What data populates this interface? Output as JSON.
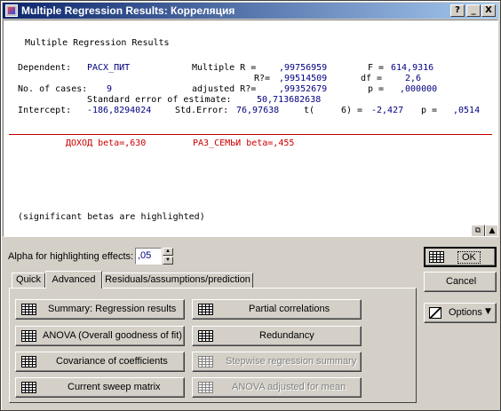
{
  "window": {
    "title": "Multiple Regression Results: Корреляция"
  },
  "titlebar_buttons": {
    "help": "?",
    "minimize": "_",
    "close": "X"
  },
  "output": {
    "heading": "Multiple Regression Results",
    "line1": {
      "dep_label": "Dependent:",
      "dep_value": "РАСХ_ПИТ",
      "multr_label": "Multiple R =",
      "multr_value": ",99756959",
      "f_label": "F =",
      "f_value": "614,9316"
    },
    "line2": {
      "r2_label": "R?=",
      "r2_value": ",99514509",
      "df_label": "df =",
      "df_value": "2,6"
    },
    "line3": {
      "cases_label": "No. of cases:",
      "cases_value": "9",
      "adjr2_label": "adjusted R?=",
      "adjr2_value": ",99352679",
      "p_label": "p =",
      "p_value": ",000000"
    },
    "line4": {
      "se_label": "Standard error of estimate:",
      "se_value": "50,713682638"
    },
    "line5": {
      "int_label": "Intercept:",
      "int_value": "-186,8294024",
      "stderr_label": "Std.Error:",
      "stderr_value": "76,97638",
      "t_label": "t(",
      "t_df": "6) =",
      "t_value": "-2,427",
      "p2_label": "p =",
      "p2_value": ",0514"
    },
    "betas": [
      {
        "text": "ДОХОД beta=,630"
      },
      {
        "text": "РАЗ_СЕМЬИ beta=,455"
      }
    ],
    "footnote": "(significant betas are highlighted)"
  },
  "alpha": {
    "label": "Alpha for highlighting effects:",
    "value": ",05"
  },
  "tabs": [
    {
      "label": "Quick"
    },
    {
      "label": "Advanced"
    },
    {
      "label": "Residuals/assumptions/prediction"
    }
  ],
  "buttons": {
    "summary": "Summary:  Regression results",
    "anova": "ANOVA (Overall goodness of fit)",
    "covariance": "Covariance of coefficients",
    "sweep": "Current sweep matrix",
    "partial": "Partial correlations",
    "redundancy": "Redundancy",
    "stepwise": "Stepwise regression summary",
    "anova_adj": "ANOVA adjusted for mean",
    "ok": "OK",
    "cancel": "Cancel",
    "options": "Options"
  },
  "colors": {
    "title_bar": "#0a246a",
    "value_text": "#000080",
    "highlight": "#cc0000"
  }
}
